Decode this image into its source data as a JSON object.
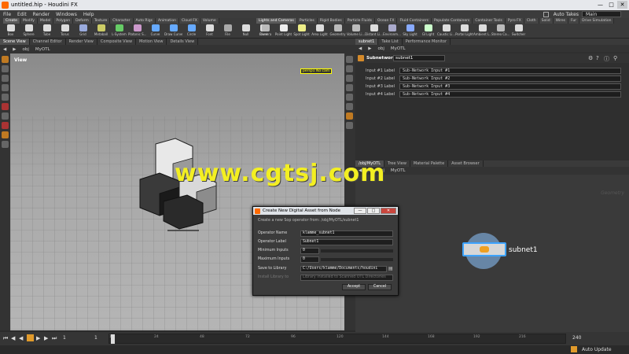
{
  "window": {
    "title": "untitled.hip - Houdini FX",
    "controls": [
      "—",
      "□",
      "✕"
    ]
  },
  "menu": {
    "items": [
      "File",
      "Edit",
      "Render",
      "Windows",
      "Help"
    ],
    "auto_takes": "Auto Takes",
    "desktop": "Main"
  },
  "shelf_left": {
    "tabs": [
      "Create",
      "Modify",
      "Model",
      "Polygon",
      "Deform",
      "Texture",
      "Character",
      "Auto Rigs",
      "Animation",
      "Cloud FX",
      "Volume"
    ],
    "tools": [
      "Box",
      "Sphere",
      "Tube",
      "Torus",
      "Grid",
      "Metaball",
      "L-System",
      "Platonic S...",
      "Curve",
      "Draw Curve",
      "Circle",
      "Font",
      "File",
      "Null",
      "Rivet"
    ]
  },
  "shelf_right": {
    "tabs": [
      "Lights and Cameras",
      "Particles",
      "Rigid Bodies",
      "Particle Fluids",
      "Ocean FX",
      "Fluid Containers",
      "Populate Containers",
      "Container Tools",
      "Pyro FX",
      "Cloth",
      "Solid",
      "Wires",
      "Fur",
      "Drive Simulation"
    ],
    "tools": [
      "Camera",
      "Point Light",
      "Spot Light",
      "Area Light",
      "Geometry",
      "Volume Li...",
      "Distant Li...",
      "Environm...",
      "Sky Light",
      "GI Light",
      "Caustic Li...",
      "Portal Light",
      "Ambient L...",
      "Stereo Ca...",
      "Switcher"
    ]
  },
  "left_tabs": [
    "Scene View",
    "Channel Editor",
    "Render View",
    "Composite View",
    "Motion View",
    "Details View"
  ],
  "left_path": {
    "root": "obj",
    "node": "MyOTL"
  },
  "viewport": {
    "title": "View",
    "camera": "persp1",
    "cam_label": "No cam"
  },
  "right_top_tabs": [
    "subnet1",
    "Take List",
    "Performance Monitor"
  ],
  "right_path": {
    "root": "obj",
    "node": "MyOTL"
  },
  "parm": {
    "type": "Subnetwork",
    "name": "subnet1",
    "rows": [
      {
        "label": "Input #1 Label",
        "value": "Sub-Network Input #1"
      },
      {
        "label": "Input #2 Label",
        "value": "Sub-Network Input #2"
      },
      {
        "label": "Input #3 Label",
        "value": "Sub-Network Input #3"
      },
      {
        "label": "Input #4 Label",
        "value": "Sub-Network Input #4"
      }
    ]
  },
  "net_tabs": [
    "/obj/MyOTL",
    "Tree View",
    "Material Palette",
    "Asset Browser"
  ],
  "net_path": {
    "root": "obj",
    "node": "MyOTL"
  },
  "net_label": "Geometry",
  "node": {
    "name": "subnet1"
  },
  "dialog": {
    "title": "Create New Digital Asset from Node",
    "info": "Create a new Sop operator from: /obj/MyOTL/subnet1",
    "op_name_label": "Operator Name",
    "op_name": "klamme_subnet1",
    "op_label_label": "Operator Label",
    "op_label": "Subnet1",
    "min_inputs_label": "Minimum Inputs",
    "min_inputs": "0",
    "max_inputs_label": "Maximum Inputs",
    "max_inputs": "0",
    "save_label": "Save to Library",
    "save_path": "C:/Users/klamme/Documents/houdini",
    "install_label": "Install Library to",
    "install_value": "Library installed to Scanned OTL Directories",
    "accept": "Accept",
    "cancel": "Cancel"
  },
  "timeline": {
    "start": "1",
    "current": "1",
    "end": "240",
    "ticks": [
      "1",
      "24",
      "48",
      "72",
      "96",
      "120",
      "144",
      "168",
      "192",
      "216"
    ]
  },
  "status": {
    "auto_update": "Auto Update"
  },
  "watermark": "www.cgtsj.com",
  "colors": {
    "accent": "#ff6a00",
    "node_ring": "#6d8fb3",
    "watermark": "#f3ef22"
  }
}
